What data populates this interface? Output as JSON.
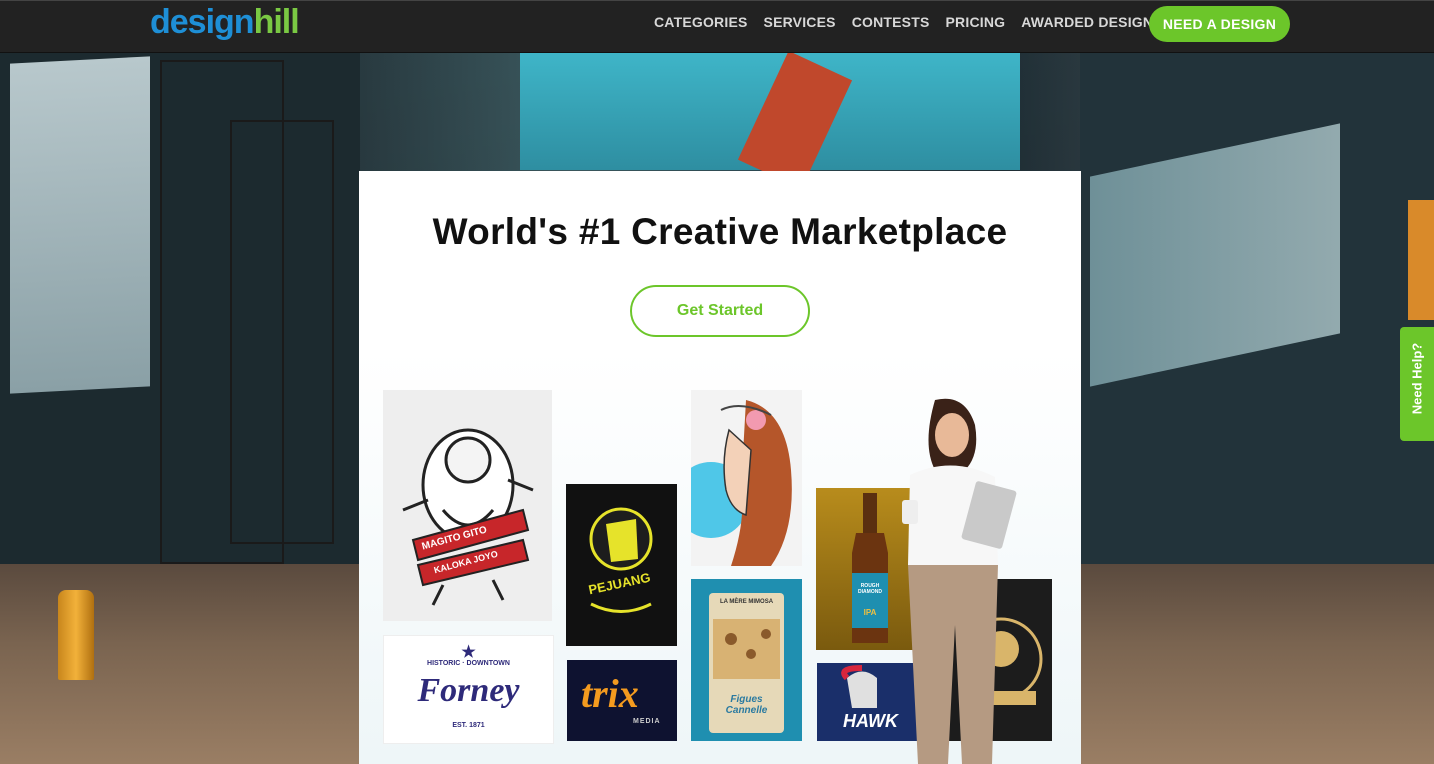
{
  "header": {
    "logo_part1": "design",
    "logo_part2": "hill",
    "nav_items": [
      "CATEGORIES",
      "SERVICES",
      "CONTESTS",
      "PRICING",
      "AWARDED DESIGNS"
    ],
    "cta_label": "NEED A DESIGN"
  },
  "hero": {
    "headline": "World's #1 Creative Marketplace",
    "button_label": "Get Started"
  },
  "tiles": {
    "ganesha_text1": "MAGITO GITO",
    "ganesha_text2": "KALOKA JOYO",
    "forney_top": "HISTORIC · DOWNTOWN",
    "forney_main": "Forney",
    "forney_bottom": "EST. 1871",
    "shirt_text": "PEJUANG",
    "trix_main": "trix",
    "trix_sub": "MEDIA",
    "pouch_brand": "LA MÈRE MIMOSA",
    "pouch_name": "Figues Cannelle",
    "beer_text": "ROUGH DIAMOND",
    "beer_sub": "IPA",
    "hawk_text": "HAWK"
  },
  "help": {
    "label": "Need Help?"
  },
  "colors": {
    "brand_blue": "#1e8fd6",
    "brand_green": "#6cc62a",
    "topbar": "#222222"
  }
}
